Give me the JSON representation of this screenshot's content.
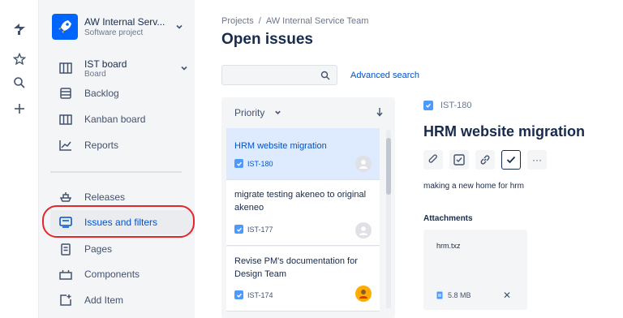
{
  "project": {
    "name": "AW Internal Serv...",
    "type": "Software project"
  },
  "sidebar": {
    "board": {
      "label": "IST board",
      "sub": "Board"
    },
    "items": [
      {
        "label": "Backlog"
      },
      {
        "label": "Kanban board"
      },
      {
        "label": "Reports"
      },
      {
        "label": "Releases"
      },
      {
        "label": "Issues and filters"
      },
      {
        "label": "Pages"
      },
      {
        "label": "Components"
      },
      {
        "label": "Add Item"
      }
    ]
  },
  "breadcrumb": {
    "root": "Projects",
    "sep": "/",
    "current": "AW Internal Service Team"
  },
  "page_title": "Open issues",
  "search": {
    "placeholder": "",
    "advanced_label": "Advanced search"
  },
  "list": {
    "sort_label": "Priority",
    "issues": [
      {
        "title": "HRM website migration",
        "key": "IST-180",
        "selected": true
      },
      {
        "title": "migrate testing akeneo to original akeneo",
        "key": "IST-177"
      },
      {
        "title": "Revise PM's documentation for Design Team",
        "key": "IST-174"
      }
    ]
  },
  "detail": {
    "key": "IST-180",
    "title": "HRM website migration",
    "more_label": "···",
    "description": "making a new home for hrm",
    "attachments_heading": "Attachments",
    "attachment": {
      "name": "hrm.txz",
      "size": "5.8 MB",
      "remove": "✕"
    }
  },
  "colors": {
    "accent": "#0052cc",
    "highlight": "#e3282d",
    "selected": "#deebff"
  }
}
